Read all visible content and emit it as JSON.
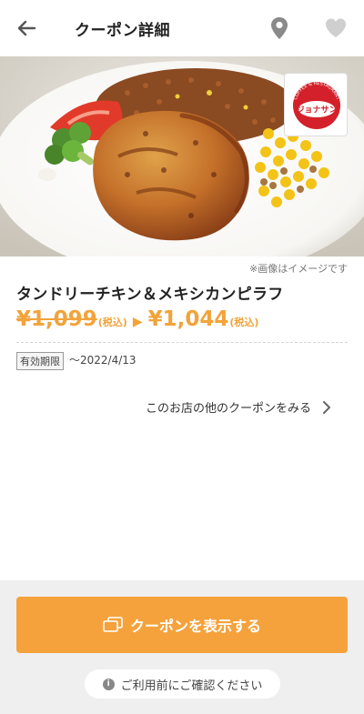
{
  "header": {
    "title": "クーポン詳細",
    "icons": [
      "back-arrow-icon",
      "location-pin-icon",
      "heart-icon"
    ]
  },
  "hero": {
    "image_note": "※画像はイメージです"
  },
  "logo": {
    "text": "ジョナサン",
    "subtext": "COFFEE & RESTAURANT",
    "color": "#d4202a"
  },
  "coupon": {
    "name": "タンドリーチキン＆メキシカンピラフ",
    "old_price": "¥1,099",
    "old_tax": "(税込)",
    "arrow": "▶",
    "new_price": "¥1,044",
    "new_tax": "(税込)",
    "period_label": "有効期限",
    "period_value": "〜2022/4/13"
  },
  "links": {
    "more_coupons": "このお店の他のクーポンをみる"
  },
  "footer": {
    "show_button": "クーポンを表示する",
    "confirm_text": "ご利用前にご確認ください",
    "info_glyph": "i"
  },
  "colors": {
    "accent": "#f5a23c",
    "price": "#f2a33a",
    "footer_bg": "#efefef"
  }
}
